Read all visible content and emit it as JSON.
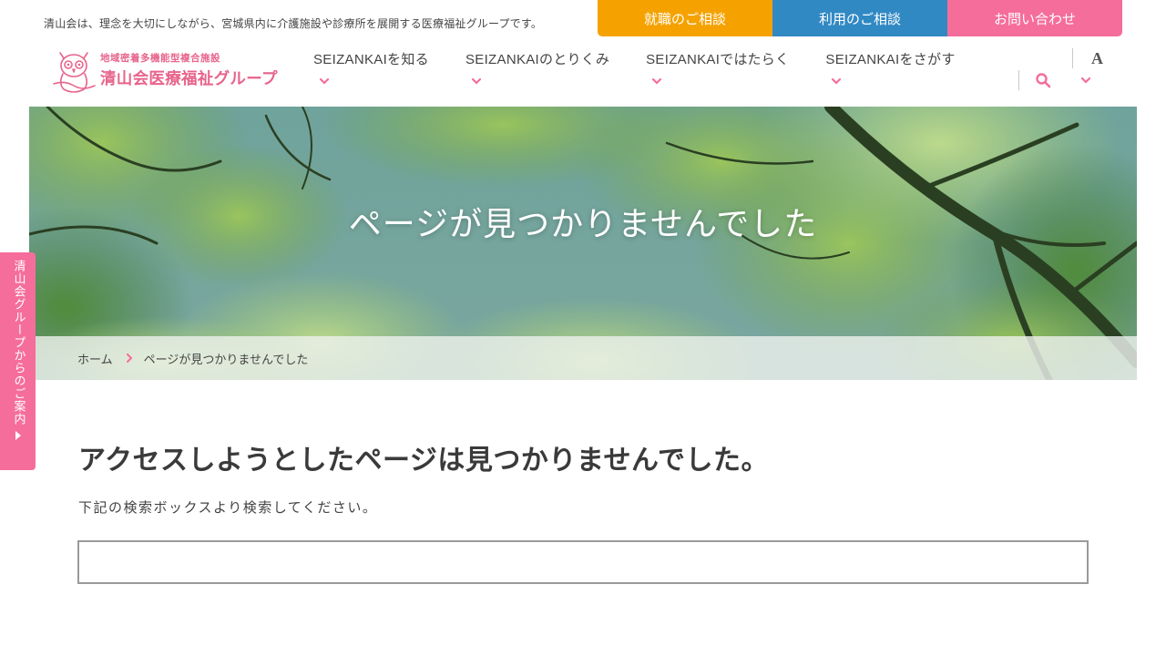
{
  "header": {
    "tagline": "清山会は、理念を大切にしながら、宮城県内に介護施設や診療所を展開する医療福祉グループです。",
    "buttons": {
      "job": "就職のご相談",
      "use": "利用のご相談",
      "contact": "お問い合わせ"
    },
    "logo": {
      "subtitle": "地域密着多機能型複合施設",
      "name": "清山会医療福祉グループ"
    },
    "nav": [
      {
        "label": "SEIZANKAIを知る"
      },
      {
        "label": "SEIZANKAIのとりくみ"
      },
      {
        "label": "SEIZANKAIではたらく"
      },
      {
        "label": "SEIZANKAIをさがす"
      }
    ],
    "font_size_label": "A"
  },
  "hero": {
    "title": "ページが見つかりませんでした"
  },
  "breadcrumb": {
    "home": "ホーム",
    "current": "ページが見つかりませんでした"
  },
  "side_tab": {
    "label": "清山会グループからのご案内"
  },
  "main": {
    "heading": "アクセスしようとしたページは見つかりませんでした。",
    "description": "下記の検索ボックスより検索してください。",
    "search_value": ""
  },
  "colors": {
    "pink": "#f56d9a",
    "orange": "#f5a200",
    "blue": "#3189c4",
    "logo_pink": "#e8648c"
  },
  "icons": {
    "search": "search-icon",
    "chevron": "chevron-down-icon",
    "breadcrumb_separator": "chevron-right-icon",
    "side_arrow": "caret-right-icon"
  }
}
